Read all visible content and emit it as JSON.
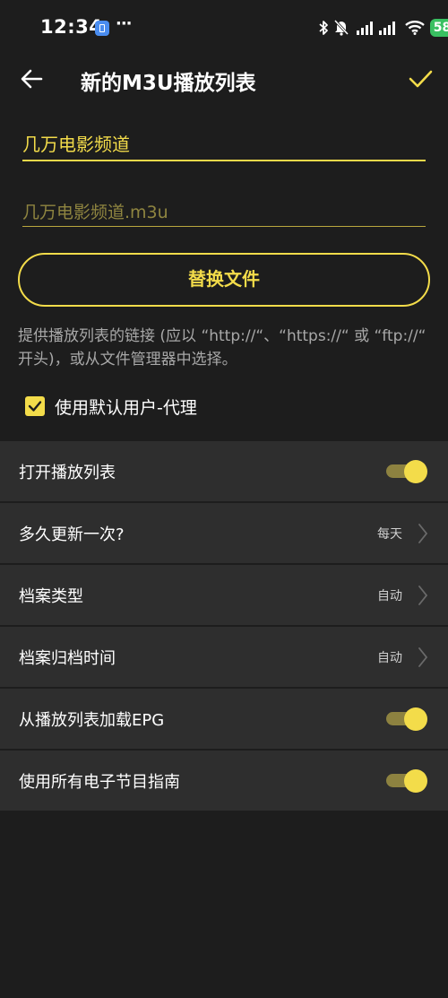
{
  "status_bar": {
    "time": "12:34",
    "more": "···",
    "battery": "58",
    "icons": [
      "app-badge-icon",
      "bluetooth-icon",
      "mute-icon",
      "signal-icon",
      "signal-icon",
      "wifi-icon",
      "battery-icon"
    ]
  },
  "header": {
    "title": "新的M3U播放列表",
    "back_icon": "arrow-left-icon",
    "confirm_icon": "check-icon"
  },
  "form": {
    "name_value": "几万电影频道",
    "file_value": "几万电影频道.m3u",
    "replace_button": "替换文件",
    "hint": "提供播放列表的链接 (应以 “http://“、“https://“ 或 “ftp://“ 开头)，或从文件管理器中选择。",
    "use_default_agent": {
      "label": "使用默认用户-代理",
      "checked": true
    }
  },
  "settings": [
    {
      "label": "打开播放列表",
      "type": "toggle",
      "on": true
    },
    {
      "label": "多久更新一次?",
      "type": "select",
      "value": "每天"
    },
    {
      "label": "档案类型",
      "type": "select",
      "value": "自动"
    },
    {
      "label": "档案归档时间",
      "type": "select",
      "value": "自动"
    },
    {
      "label": "从播放列表加载EPG",
      "type": "toggle",
      "on": true
    },
    {
      "label": "使用所有电子节目指南",
      "type": "toggle",
      "on": true
    }
  ],
  "colors": {
    "accent": "#f3dc4a",
    "background": "#1d1d1d",
    "row_background": "#2e2e2e",
    "hint_text": "#a8a8a8"
  }
}
